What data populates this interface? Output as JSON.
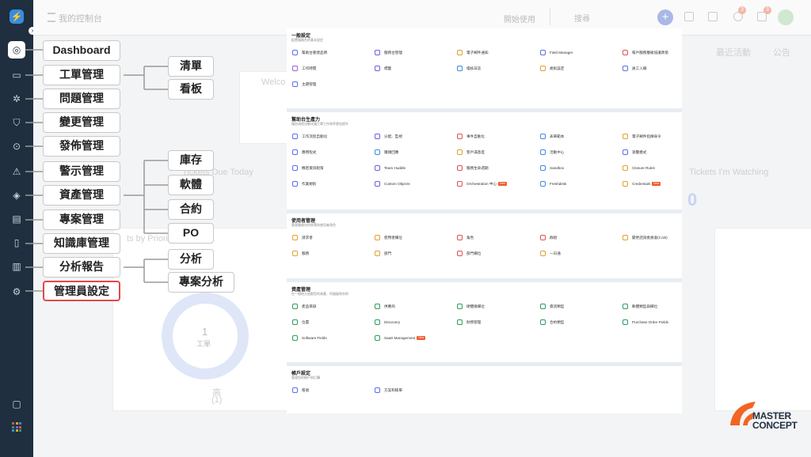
{
  "topbar": {
    "title": "我的控制台",
    "start": "開始使用",
    "search_placeholder": "搜尋",
    "badge_1": "3",
    "badge_2": "3"
  },
  "background": {
    "welcome": "Welco",
    "activity": "最近活動",
    "announce": "公告",
    "due_today": "Tickets Due Today",
    "watching": "Tickets I'm Watching",
    "watching_count": "0",
    "by_priority": "ts by Priority",
    "donut_value": "1",
    "donut_label": "工單",
    "legend_1": "高",
    "legend_2": "(1)"
  },
  "mindmap": {
    "root": [
      {
        "label": "Dashboard",
        "icon": "speedometer-icon"
      },
      {
        "label": "工單管理",
        "icon": "ticket-icon"
      },
      {
        "label": "問題管理",
        "icon": "bug-icon"
      },
      {
        "label": "變更管理",
        "icon": "change-icon"
      },
      {
        "label": "發佈管理",
        "icon": "release-icon"
      },
      {
        "label": "警示管理",
        "icon": "alert-icon"
      },
      {
        "label": "資產管理",
        "icon": "asset-icon"
      },
      {
        "label": "專案管理",
        "icon": "project-icon"
      },
      {
        "label": "知識庫管理",
        "icon": "book-icon"
      },
      {
        "label": "分析報告",
        "icon": "analytics-icon"
      },
      {
        "label": "管理員設定",
        "icon": "gear-icon"
      }
    ],
    "ticket_children": [
      "清單",
      "看板"
    ],
    "asset_children": [
      "庫存",
      "軟體",
      "合約",
      "PO"
    ],
    "analytics_children": [
      "分析",
      "專案分析"
    ]
  },
  "panel": {
    "sections": [
      {
        "title": "一般設定",
        "desc": "配置服務台的基本設定",
        "items": [
          {
            "label": "幫助台重建品牌",
            "color": "#5b6ee8"
          },
          {
            "label": "服務台管理",
            "color": "#7b5bd6"
          },
          {
            "label": "電子郵件通知",
            "color": "#e0a030"
          },
          {
            "label": "Field Manager",
            "color": "#5b6ee8"
          },
          {
            "label": "帳戶服務層級協議政策",
            "color": "#e05050"
          },
          {
            "label": "工作時間",
            "color": "#a05bd6"
          },
          {
            "label": "標籤",
            "color": "#7b5bd6"
          },
          {
            "label": "稽核日誌",
            "color": "#3a8be0"
          },
          {
            "label": "規則設定",
            "color": "#e0a030"
          },
          {
            "label": "員工入職",
            "color": "#5b6ee8"
          },
          {
            "label": "主題管理",
            "color": "#5b6ee8"
          }
        ]
      },
      {
        "title": "幫助台生產力",
        "desc": "藉由流程自動化讓工單工作效率更加提升",
        "items": [
          {
            "label": "工作流程自動化",
            "color": "#5b6ee8"
          },
          {
            "label": "分配、監視",
            "color": "#7b5bd6"
          },
          {
            "label": "事件自動化",
            "color": "#e05050"
          },
          {
            "label": "表單範本",
            "color": "#3a8be0"
          },
          {
            "label": "電子郵件指揮命令",
            "color": "#e0a030"
          },
          {
            "label": "應用程式",
            "color": "#5b6ee8"
          },
          {
            "label": "罐頭回應",
            "color": "#3a8be0"
          },
          {
            "label": "客戶滿意度",
            "color": "#e0a030"
          },
          {
            "label": "活動中心",
            "color": "#3a8be0"
          },
          {
            "label": "瀏覽模式",
            "color": "#5b6ee8"
          },
          {
            "label": "機密資訊組策",
            "color": "#5b6ee8"
          },
          {
            "label": "Team Huddle",
            "color": "#7b5bd6"
          },
          {
            "label": "服務生命週期",
            "color": "#e05050"
          },
          {
            "label": "Sandbox",
            "color": "#3a8be0"
          },
          {
            "label": "Closure Rules",
            "color": "#e0a030"
          },
          {
            "label": "作業規則",
            "color": "#5b6ee8"
          },
          {
            "label": "Custom Objects",
            "color": "#7b5bd6"
          },
          {
            "label": "Orchestration 中心",
            "color": "#e05050",
            "badge": "New"
          },
          {
            "label": "Freshdesk",
            "color": "#3a8be0"
          },
          {
            "label": "Credentials",
            "color": "#e0a030",
            "badge": "New"
          }
        ]
      },
      {
        "title": "使用者管理",
        "desc": "管理服務台的負責與使用者角色",
        "items": [
          {
            "label": "請求者",
            "color": "#e0a030"
          },
          {
            "label": "使用者欄位",
            "color": "#e0a030"
          },
          {
            "label": "角色",
            "color": "#e05050"
          },
          {
            "label": "群組",
            "color": "#e05050"
          },
          {
            "label": "變更諮詢委員會(CAB)",
            "color": "#e0a030"
          },
          {
            "label": "服務",
            "color": "#e0a030"
          },
          {
            "label": "部門",
            "color": "#e0a030"
          },
          {
            "label": "部門欄位",
            "color": "#e05050"
          },
          {
            "label": "一日通",
            "color": "#e0a030"
          }
        ]
      },
      {
        "title": "資產管理",
        "desc": "在一個地方追蹤您的資產、伺服器和合約",
        "items": [
          {
            "label": "產品目錄",
            "color": "#2a9d5c"
          },
          {
            "label": "供應商",
            "color": "#2a9d5c"
          },
          {
            "label": "硬體幾欄位",
            "color": "#2a9d5c"
          },
          {
            "label": "資訊類型",
            "color": "#2a9d5c"
          },
          {
            "label": "軟體類型與欄位",
            "color": "#2a9d5c"
          },
          {
            "label": "位置",
            "color": "#2a9d5c"
          },
          {
            "label": "Discovery",
            "color": "#2a9d5c"
          },
          {
            "label": "財務管理",
            "color": "#2a9d5c"
          },
          {
            "label": "合約類型",
            "color": "#2a9d5c"
          },
          {
            "label": "Purchase Order Fields",
            "color": "#2a9d5c"
          },
          {
            "label": "Software Fields",
            "color": "#2a9d5c"
          },
          {
            "label": "SaaS Management",
            "color": "#2a9d5c",
            "badge": "New"
          }
        ]
      },
      {
        "title": "帳戶設定",
        "desc": "管理您的帳戶與訂購",
        "items": [
          {
            "label": "帳號",
            "color": "#5b6ee8"
          },
          {
            "label": "方案和帳單",
            "color": "#5b6ee8"
          }
        ]
      }
    ]
  },
  "brand": {
    "line1": "MASTER",
    "line2": "CONCEPT",
    "color": "#f26522"
  }
}
